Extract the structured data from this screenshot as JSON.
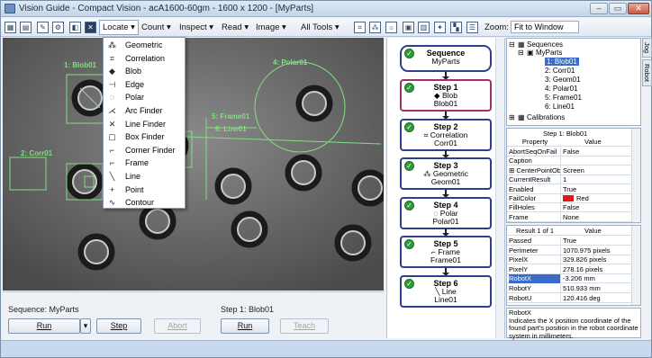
{
  "window": {
    "title": "Vision Guide - Compact Vision - acA1600-60gm - 1600 x 1200 - [MyParts]",
    "min_label": "–",
    "max_label": "▭",
    "close_label": "✕"
  },
  "toolbar": {
    "menus": [
      "Locate ▾",
      "Count ▾",
      "Inspect ▾",
      "Read ▾",
      "Image ▾",
      "All Tools ▾"
    ],
    "zoom_label": "Zoom:",
    "zoom_value": "Fit to Window"
  },
  "locate_menu": [
    {
      "label": "Geometric",
      "icon": "geometric-icon",
      "glyph": "⁂"
    },
    {
      "label": "Correlation",
      "icon": "correlation-icon",
      "glyph": "⌗"
    },
    {
      "label": "Blob",
      "icon": "blob-icon",
      "glyph": "◆"
    },
    {
      "label": "Edge",
      "icon": "edge-icon",
      "glyph": "⊣"
    },
    {
      "label": "Polar",
      "icon": "polar-icon",
      "glyph": "◌"
    },
    {
      "label": "Arc Finder",
      "icon": "arc-finder-icon",
      "glyph": "⋌"
    },
    {
      "label": "Line Finder",
      "icon": "line-finder-icon",
      "glyph": "✕"
    },
    {
      "label": "Box Finder",
      "icon": "box-finder-icon",
      "glyph": "▢"
    },
    {
      "label": "Corner Finder",
      "icon": "corner-finder-icon",
      "glyph": "⌐"
    },
    {
      "label": "Frame",
      "icon": "frame-icon",
      "glyph": "⌐"
    },
    {
      "label": "Line",
      "icon": "line-icon",
      "glyph": "╲"
    },
    {
      "label": "Point",
      "icon": "point-icon",
      "glyph": "+"
    },
    {
      "label": "Contour",
      "icon": "contour-icon",
      "glyph": "∿"
    }
  ],
  "overlays": {
    "blob": "1: Blob01",
    "corr": "2: Corr01",
    "frame": "5: Frame01",
    "line": "6: Line01",
    "polar": "4: Polar01"
  },
  "sequence_panel": {
    "sequence_label": "Sequence: MyParts",
    "run": "Run",
    "step": "Step",
    "abort": "Abort",
    "step_label": "Step 1: Blob01",
    "step_run": "Run",
    "teach": "Teach"
  },
  "flow": {
    "sequence": {
      "title": "Sequence",
      "name": "MyParts"
    },
    "steps": [
      {
        "title": "Step 1",
        "type": "Blob",
        "name": "Blob01",
        "icon": "blob-icon",
        "glyph": "◆"
      },
      {
        "title": "Step 2",
        "type": "Correlation",
        "name": "Corr01",
        "icon": "correlation-icon",
        "glyph": "⌗"
      },
      {
        "title": "Step 3",
        "type": "Geometric",
        "name": "Geom01",
        "icon": "geometric-icon",
        "glyph": "⁂"
      },
      {
        "title": "Step 4",
        "type": "Polar",
        "name": "Polar01",
        "icon": "polar-icon",
        "glyph": "◌"
      },
      {
        "title": "Step 5",
        "type": "Frame",
        "name": "Frame01",
        "icon": "frame-icon",
        "glyph": "⌐"
      },
      {
        "title": "Step 6",
        "type": "Line",
        "name": "Line01",
        "icon": "line-icon",
        "glyph": "╲"
      }
    ]
  },
  "tree": {
    "root": "Sequences",
    "seq": "MyParts",
    "items": [
      "1: Blob01",
      "2: Corr01",
      "3: Geom01",
      "4: Polar01",
      "5: Frame01",
      "6: Line01"
    ],
    "calibrations": "Calibrations"
  },
  "props": {
    "header": "Step 1: Blob01",
    "col_property": "Property",
    "col_value": "Value",
    "rows": [
      {
        "k": "AbortSeqOnFail",
        "v": "False"
      },
      {
        "k": "Caption",
        "v": ""
      },
      {
        "k": "⊞ CenterPointObject",
        "v": "Screen"
      },
      {
        "k": "CurrentResult",
        "v": "1"
      },
      {
        "k": "Enabled",
        "v": "True"
      },
      {
        "k": "FailColor",
        "v": "Red"
      },
      {
        "k": "FillHoles",
        "v": "False"
      },
      {
        "k": "Frame",
        "v": "None"
      }
    ],
    "fail_color": "#e01818"
  },
  "results": {
    "header": "Result 1 of 1",
    "col_value": "Value",
    "rows": [
      {
        "k": "Passed",
        "v": "True"
      },
      {
        "k": "Perimeter",
        "v": "1070.975 pixels"
      },
      {
        "k": "PixelX",
        "v": "329.826 pixels"
      },
      {
        "k": "PixelY",
        "v": "278.16 pixels"
      },
      {
        "k": "RobotX",
        "v": "-3.206 mm"
      },
      {
        "k": "RobotY",
        "v": "510.933 mm"
      },
      {
        "k": "RobotU",
        "v": "120.416 deg"
      }
    ]
  },
  "description": {
    "title": "RobotX",
    "text": "Indicates the X position coordinate of the found part's position in the robot coordinate system in millimeters."
  },
  "side_tabs": [
    "Jog",
    "Robot"
  ]
}
